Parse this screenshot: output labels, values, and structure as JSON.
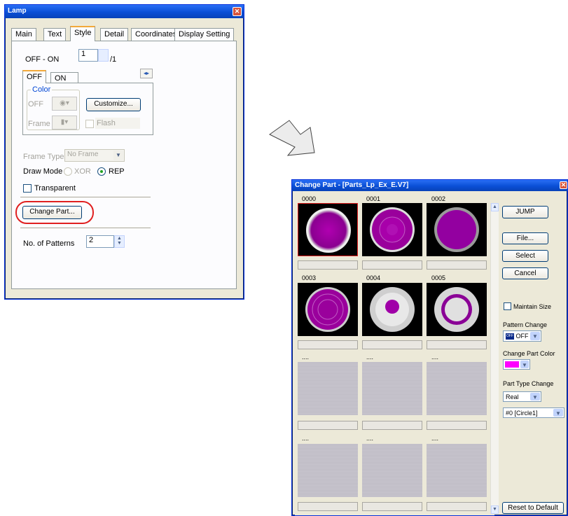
{
  "lamp": {
    "title": "Lamp",
    "tabs": [
      "Main",
      "Text",
      "Style",
      "Detail",
      "Coordinates",
      "Display Setting"
    ],
    "offon_label": "OFF - ON",
    "offon_value": "1",
    "offon_total": "/1",
    "subtabs": [
      "OFF",
      "ON"
    ],
    "color_group": "Color",
    "off_label": "OFF",
    "frame_label": "Frame",
    "customize": "Customize...",
    "flash": "Flash",
    "frame_type_label": "Frame Type",
    "frame_type_value": "No Frame",
    "draw_mode_label": "Draw Mode",
    "xor": "XOR",
    "rep": "REP",
    "transparent": "Transparent",
    "change_part": "Change Part...",
    "patterns_label": "No. of Patterns",
    "patterns_value": "2"
  },
  "change": {
    "title": "Change Part - [Parts_Lp_Ex_E.V7]",
    "headers": [
      "0000",
      "0001",
      "0002",
      "0003",
      "0004",
      "0005",
      "....",
      "....",
      "....",
      "....",
      "....",
      "...."
    ],
    "jump": "JUMP",
    "file": "File...",
    "select": "Select",
    "cancel": "Cancel",
    "maintain_size": "Maintain Size",
    "pattern_change": "Pattern Change",
    "pattern_value": "OFF",
    "pattern_badge": "OFF",
    "change_color": "Change Part Color",
    "color_value": "#ff00ff",
    "part_type_change": "Part Type Change",
    "part_type_value": "Real",
    "shape_value": "#0 [Circle1]",
    "reset": "Reset to Default"
  },
  "colors": {
    "accent": "#0a4fd6",
    "highlight": "#e02020",
    "part": "#a000a0"
  }
}
